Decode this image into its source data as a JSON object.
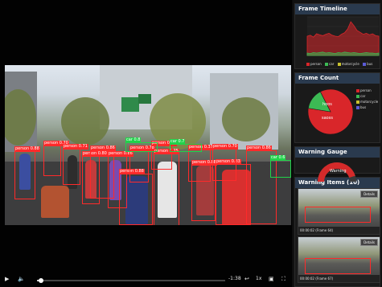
{
  "player": {
    "time": "-1:38",
    "speed": "1x",
    "progress": 0.02
  },
  "detections": [
    {
      "label": "person 0.88"
    },
    {
      "label": "person 0.70"
    },
    {
      "label": "person 0.71"
    },
    {
      "label": "person 0.80"
    },
    {
      "label": "person 0.86"
    },
    {
      "label": "person 0.86"
    },
    {
      "label": "person 0.88"
    },
    {
      "label": "person 0.78"
    },
    {
      "label": "person 0.75"
    },
    {
      "label": "person 0.37"
    },
    {
      "label": "person 0.88"
    },
    {
      "label": "person 0.83"
    },
    {
      "label": "person 0.70"
    },
    {
      "label": "person 0.86"
    },
    {
      "label": "person 0.71"
    }
  ],
  "car_detections": [
    {
      "label": "car 0.8"
    },
    {
      "label": "car 0.7"
    },
    {
      "label": "car 0.6"
    }
  ],
  "panels": {
    "timeline": {
      "title": "Frame Timeline",
      "legend": [
        "person",
        "car",
        "motorcycle",
        "bus"
      ]
    },
    "count": {
      "title": "Frame Count",
      "slices": [
        {
          "name": "person",
          "short": "",
          "value": 85
        },
        {
          "name": "car",
          "short": "",
          "value": 15
        },
        {
          "name": "motorcycle",
          "short": "",
          "value": 0
        },
        {
          "name": "bus",
          "short": "",
          "value": 0
        }
      ],
      "labels": {
        "a": "hoos",
        "b": "saoss"
      },
      "legend": [
        "person",
        "car",
        "motorcycle",
        "bus"
      ]
    },
    "gauge": {
      "title": "Warning Gauge",
      "label": "Warning",
      "level": 0.9
    },
    "warnings": {
      "title": "Warning Items (10)",
      "items": [
        {
          "caption": "00:00:02  (Frame 64)",
          "button": "Details"
        },
        {
          "caption": "00:00:02  (Frame 67)",
          "button": "Details"
        }
      ]
    }
  },
  "colors": {
    "person": "#d9262a",
    "car": "#3cba54",
    "motorcycle": "#c9c12e",
    "bus": "#5b5bd6",
    "accent_header": "#2a3a4e",
    "box_red": "#ff2a2a",
    "box_green": "#21d34a"
  },
  "timeline_series": {
    "person": [
      40,
      42,
      38,
      45,
      43,
      41,
      44,
      46,
      42,
      40,
      39,
      44,
      47,
      55,
      70,
      62,
      52,
      48,
      44,
      46,
      43,
      45,
      41,
      40
    ],
    "car": [
      5,
      4,
      6,
      5,
      6,
      7,
      5,
      6,
      5,
      4,
      6,
      5,
      7,
      6,
      5,
      6,
      5,
      4,
      5,
      6,
      5,
      5,
      4,
      5
    ]
  }
}
